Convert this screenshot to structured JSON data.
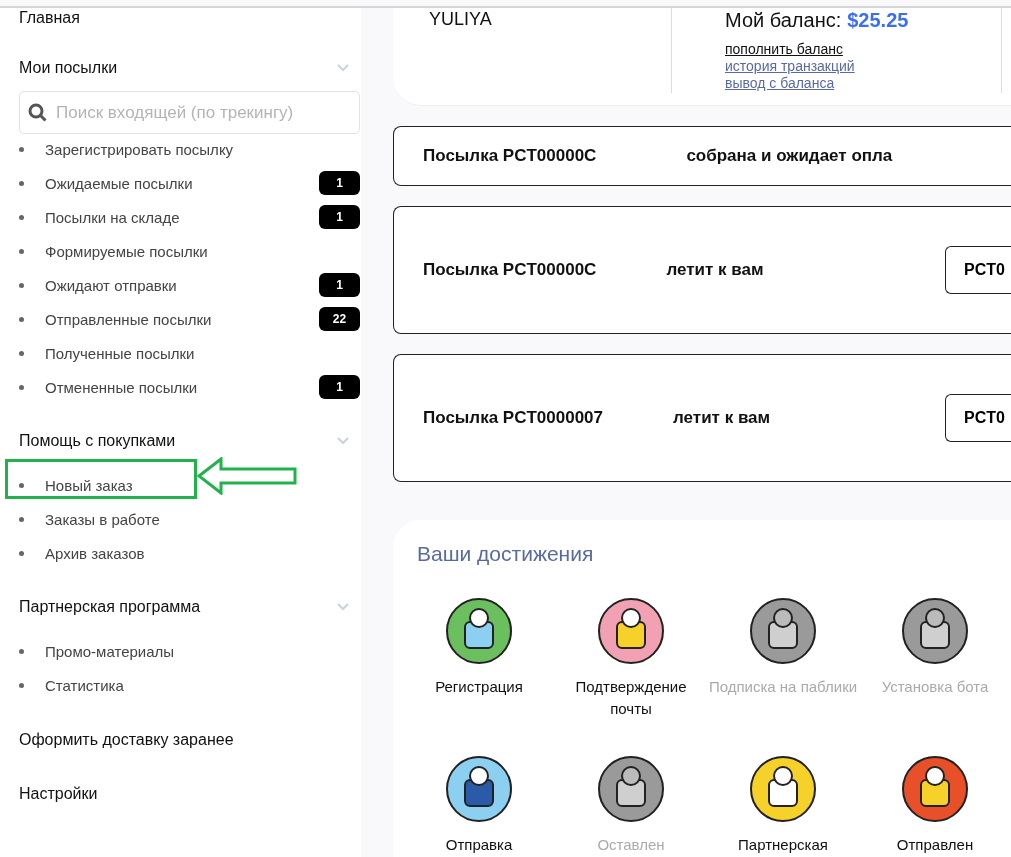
{
  "sidebar": {
    "home": "Главная",
    "sections": [
      {
        "title": "Мои посылки",
        "expanded": true,
        "search": {
          "placeholder": "Поиск входящей (по трекингу)"
        },
        "items": [
          {
            "label": "Зарегистрировать посылку",
            "highlighted": false
          },
          {
            "label": "Ожидаемые посылки",
            "badge": "1",
            "highlighted": false
          },
          {
            "label": "Посылки на складе",
            "badge": "1",
            "highlighted": false
          },
          {
            "label": "Формируемые посылки",
            "highlighted": false
          },
          {
            "label": "Ожидают отправки",
            "badge": "1",
            "highlighted": false
          },
          {
            "label": "Отправленные посылки",
            "badge": "22",
            "highlighted": false
          },
          {
            "label": "Полученные посылки",
            "highlighted": false
          },
          {
            "label": "Отмененные посылки",
            "badge": "1",
            "highlighted": false
          }
        ]
      },
      {
        "title": "Помощь с покупками",
        "expanded": true,
        "items": [
          {
            "label": "Новый заказ",
            "highlighted": true
          },
          {
            "label": "Заказы в работе",
            "highlighted": false
          },
          {
            "label": "Архив заказов",
            "highlighted": false
          }
        ]
      },
      {
        "title": "Партнерская программа",
        "expanded": true,
        "items": [
          {
            "label": "Промо-материалы",
            "highlighted": false
          },
          {
            "label": "Статистика",
            "highlighted": false
          }
        ]
      }
    ],
    "links": [
      "Оформить доставку заранее",
      "Настройки"
    ]
  },
  "profile": {
    "name": "YULIYA",
    "balance_label": "Мой баланс:",
    "balance": "$25.25",
    "links": [
      "пополнить баланс",
      "история транзакций",
      "вывод с баланса"
    ]
  },
  "notices": [
    {
      "kind": "plain",
      "id": "Посылка PCT00000C",
      "status": "собрана и ожидает опла"
    },
    {
      "kind": "button",
      "id": "Посылка PCT00000C",
      "status": "летит к вам",
      "button": "PCT0"
    },
    {
      "kind": "button",
      "id": "Посылка PCT0000007",
      "status": "летит к вам",
      "button": "PCT0"
    }
  ],
  "achievements": {
    "title": "Ваши достижения",
    "items": [
      {
        "label": "Регистрация",
        "achieved": true
      },
      {
        "label": "Подтверждение почты",
        "achieved": true
      },
      {
        "label": "Подписка на паблики",
        "achieved": false
      },
      {
        "label": "Установка бота",
        "achieved": false
      },
      {
        "label": "Отправка",
        "achieved": true
      },
      {
        "label": "Оставлен",
        "achieved": false
      },
      {
        "label": "Партнерская",
        "achieved": true
      },
      {
        "label": "Отправлен",
        "achieved": true
      }
    ]
  }
}
